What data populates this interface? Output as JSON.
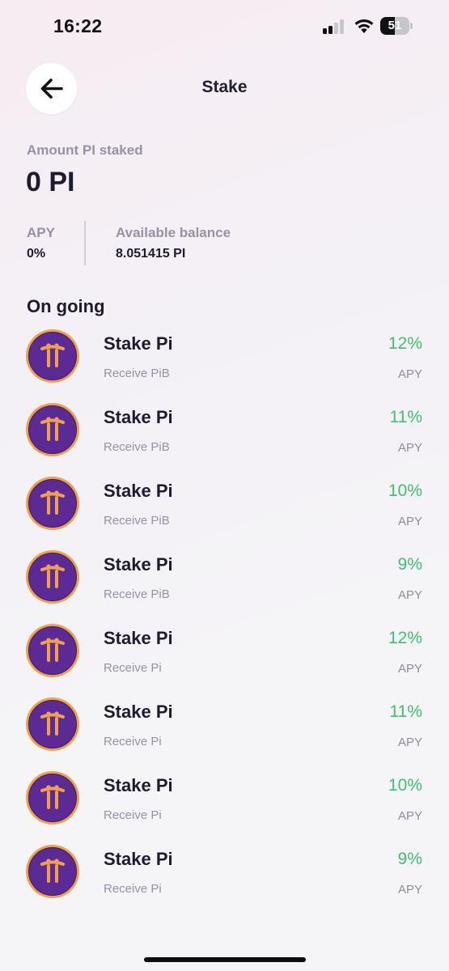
{
  "status_bar": {
    "time": "16:22",
    "battery": "51",
    "battery_level": 0.51
  },
  "header": {
    "title": "Stake"
  },
  "summary": {
    "amount_label": "Amount PI staked",
    "amount_value": "0 PI",
    "apy_label": "APY",
    "apy_value": "0%",
    "balance_label": "Available balance",
    "balance_value": "8.051415 PI"
  },
  "section_title": "On going",
  "items": [
    {
      "title": "Stake Pi",
      "subtitle": "Receive PiB",
      "rate": "12%",
      "rate_label": "APY"
    },
    {
      "title": "Stake Pi",
      "subtitle": "Receive PiB",
      "rate": "11%",
      "rate_label": "APY"
    },
    {
      "title": "Stake Pi",
      "subtitle": "Receive PiB",
      "rate": "10%",
      "rate_label": "APY"
    },
    {
      "title": "Stake Pi",
      "subtitle": "Receive PiB",
      "rate": "9%",
      "rate_label": "APY"
    },
    {
      "title": "Stake Pi",
      "subtitle": "Receive Pi",
      "rate": "12%",
      "rate_label": "APY"
    },
    {
      "title": "Stake Pi",
      "subtitle": "Receive Pi",
      "rate": "11%",
      "rate_label": "APY"
    },
    {
      "title": "Stake Pi",
      "subtitle": "Receive Pi",
      "rate": "10%",
      "rate_label": "APY"
    },
    {
      "title": "Stake Pi",
      "subtitle": "Receive Pi",
      "rate": "9%",
      "rate_label": "APY"
    }
  ],
  "colors": {
    "accent_green": "#3fbf72",
    "pi_purple": "#5c2a94",
    "pi_gold": "#f0a24a"
  },
  "icons": {
    "back": "arrow-left-icon",
    "coin": "pi-coin-icon"
  }
}
